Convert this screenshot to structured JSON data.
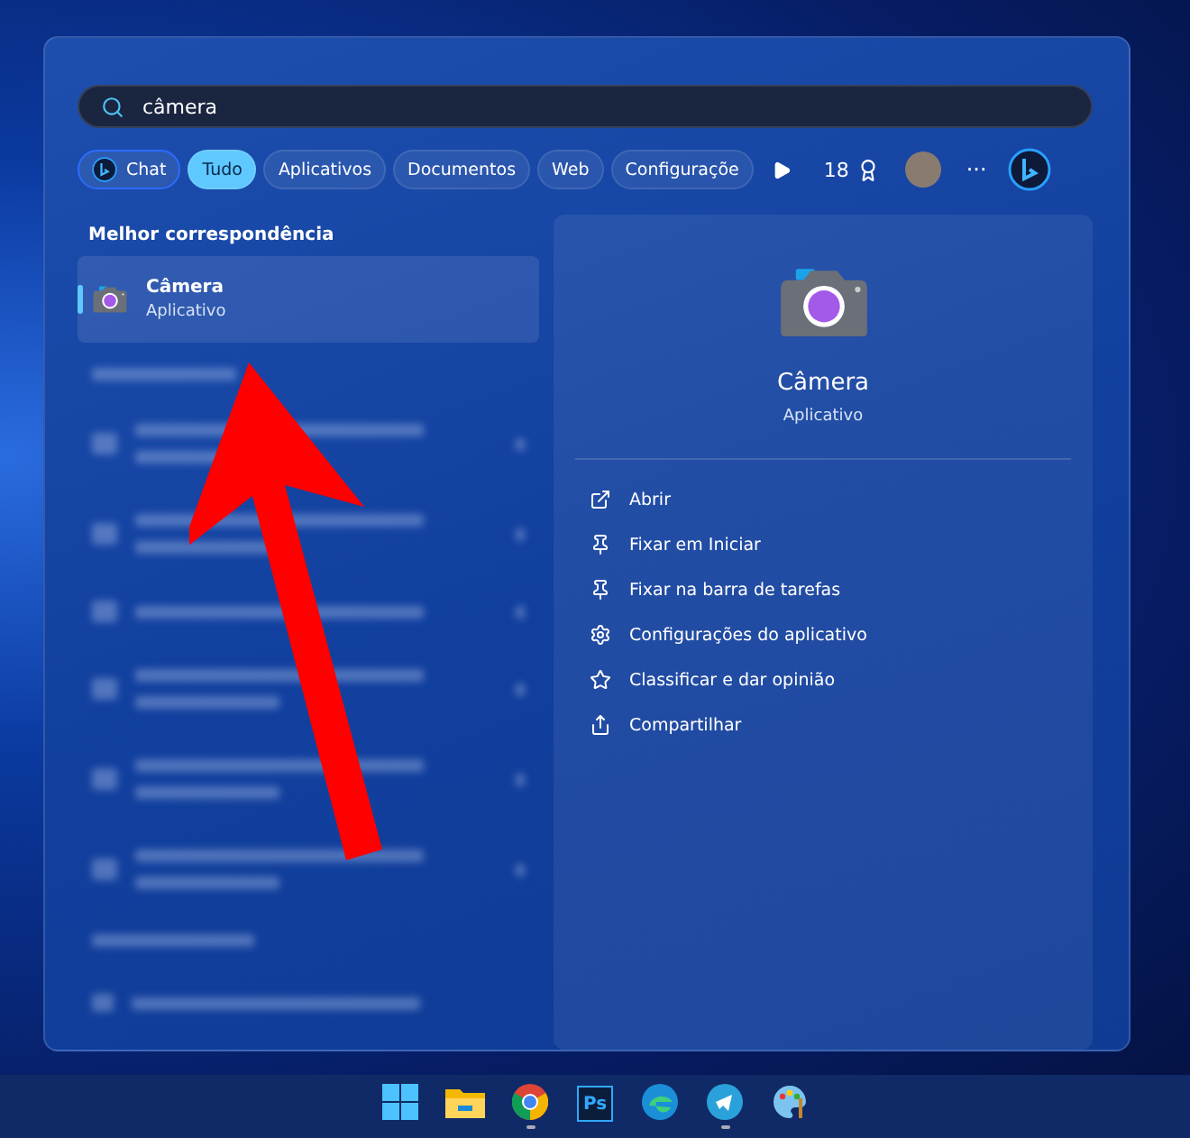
{
  "search": {
    "value": "câmera"
  },
  "filters": [
    {
      "label": "Chat",
      "kind": "chat",
      "selected": false
    },
    {
      "label": "Tudo",
      "kind": "plain",
      "selected": true
    },
    {
      "label": "Aplicativos",
      "kind": "plain",
      "selected": false
    },
    {
      "label": "Documentos",
      "kind": "plain",
      "selected": false
    },
    {
      "label": "Web",
      "kind": "plain",
      "selected": false
    },
    {
      "label": "Configuraçõe",
      "kind": "plain",
      "selected": false
    }
  ],
  "points": "18",
  "more": "···",
  "results": {
    "heading": "Melhor correspondência",
    "best": {
      "name": "Câmera",
      "type": "Aplicativo",
      "selected": true
    }
  },
  "detail": {
    "name": "Câmera",
    "type": "Aplicativo",
    "actions": [
      {
        "label": "Abrir",
        "kind": "open"
      },
      {
        "label": "Fixar em Iniciar",
        "kind": "pin"
      },
      {
        "label": "Fixar na barra de tarefas",
        "kind": "pin"
      },
      {
        "label": "Configurações do aplicativo",
        "kind": "settings"
      },
      {
        "label": "Classificar e dar opinião",
        "kind": "rate"
      },
      {
        "label": "Compartilhar",
        "kind": "share"
      }
    ]
  },
  "taskbar": [
    {
      "kind": "start",
      "running": false
    },
    {
      "kind": "folder",
      "running": false
    },
    {
      "kind": "chrome",
      "running": true
    },
    {
      "kind": "ps",
      "label": "Ps",
      "running": false
    },
    {
      "kind": "edge",
      "running": false
    },
    {
      "kind": "telegram",
      "running": true
    },
    {
      "kind": "paint",
      "running": false
    }
  ]
}
